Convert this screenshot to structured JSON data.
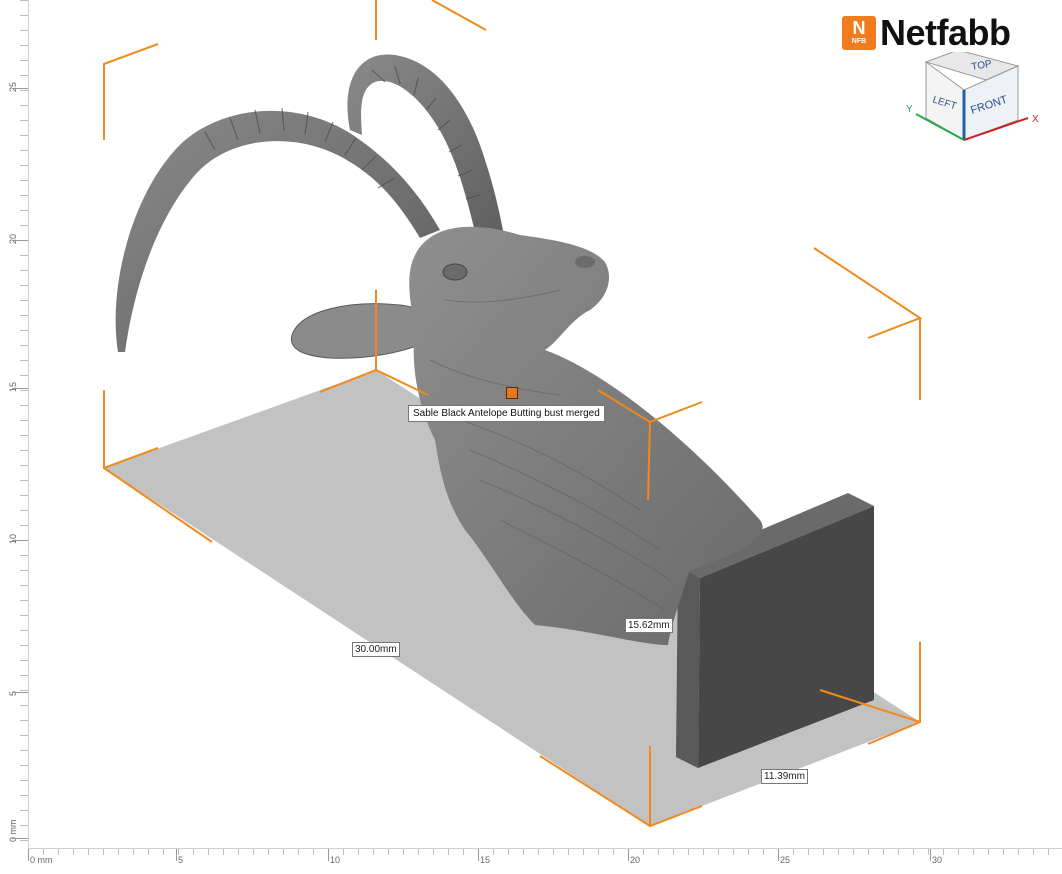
{
  "app": {
    "logo_badge": "N",
    "logo_badge_sub": "NFB",
    "logo_text": "Netfabb"
  },
  "viewcube": {
    "top": "TOP",
    "left": "LEFT",
    "front": "FRONT",
    "axis_x": "X",
    "axis_y": "Y"
  },
  "part": {
    "name": "Sable Black Antelope Butting bust merged"
  },
  "dimensions": {
    "length": "30.00mm",
    "height": "15.62mm",
    "width": "11.39mm"
  },
  "ruler_left": {
    "labels": [
      "25",
      "20",
      "15",
      "10",
      "5",
      "0 mm"
    ]
  },
  "ruler_bottom": {
    "labels": [
      "0 mm",
      "5",
      "10",
      "15",
      "20",
      "25",
      "30"
    ]
  },
  "colors": {
    "bounding_box": "#f08a1c",
    "model": "#7a7a7a",
    "build_plate": "#bdbdbd",
    "support_block": "#4a4a4a",
    "accent": "#f07c1e"
  }
}
